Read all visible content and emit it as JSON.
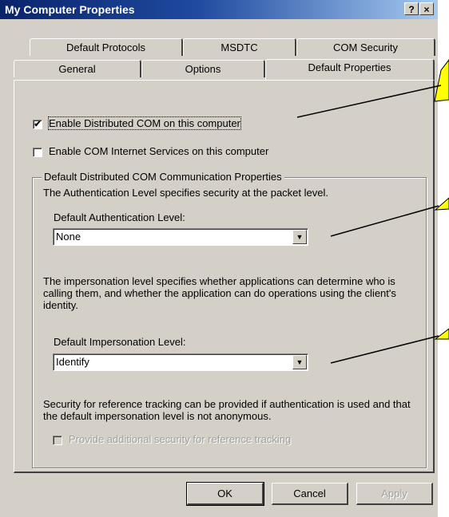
{
  "window": {
    "title": "My Computer Properties",
    "help_button": "?",
    "close_button": "×"
  },
  "tabs": {
    "row1": [
      "Default Protocols",
      "MSDTC",
      "COM Security"
    ],
    "row2": [
      "General",
      "Options",
      "Default Properties"
    ],
    "active": "Default Properties"
  },
  "options": {
    "enable_dcom": {
      "label": "Enable Distributed COM on this computer",
      "checked": true
    },
    "enable_cis": {
      "label": "Enable COM Internet Services on this computer",
      "checked": false
    }
  },
  "group": {
    "title": "Default Distributed COM Communication Properties",
    "auth_desc": "The Authentication Level specifies security at the packet level.",
    "auth_label": "Default Authentication Level:",
    "auth_value": "None",
    "imp_desc": "The impersonation level specifies whether applications can determine who is calling them, and whether the application can do operations using the client's identity.",
    "imp_label": "Default Impersonation Level:",
    "imp_value": "Identify",
    "ref_desc": "Security for reference tracking can be provided if authentication is used and that the default impersonation level is not anonymous.",
    "ref_check": {
      "label": "Provide additional security for reference tracking",
      "checked": false,
      "enabled": false
    }
  },
  "buttons": {
    "ok": "OK",
    "cancel": "Cancel",
    "apply": "Apply"
  },
  "icons": {
    "checkmark": "checkmark-icon",
    "dropdown": "chevron-down-icon"
  },
  "colors": {
    "titlebar_start": "#0a246a",
    "titlebar_end": "#a6caf0",
    "dialog_face": "#d4d0c8",
    "callout": "#ffff00"
  }
}
